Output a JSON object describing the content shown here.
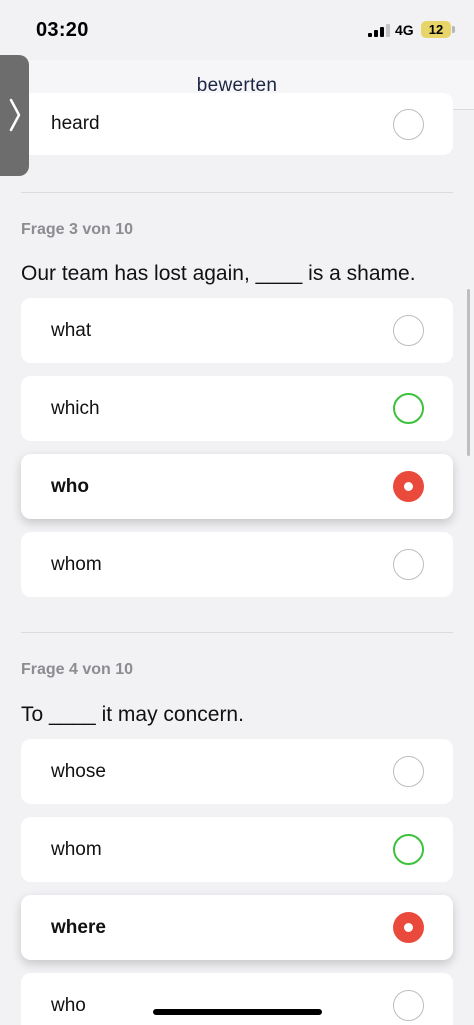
{
  "status_bar": {
    "time": "03:20",
    "network": "4G",
    "battery": "12",
    "battery_color": "#e8d56a"
  },
  "nav": {
    "title": "bewerten",
    "side_tab_icon": "chevron-right-icon"
  },
  "prev_question": {
    "options": [
      {
        "label": "heard",
        "state": "unselected"
      }
    ]
  },
  "questions": [
    {
      "counter": "Frage 3 von 10",
      "text": "Our team has lost again, ____ is a shame.",
      "options": [
        {
          "label": "what",
          "state": "unselected"
        },
        {
          "label": "which",
          "state": "correct"
        },
        {
          "label": "who",
          "state": "selected-wrong"
        },
        {
          "label": "whom",
          "state": "unselected"
        }
      ]
    },
    {
      "counter": "Frage 4 von 10",
      "text": "To ____ it may concern.",
      "options": [
        {
          "label": "whose",
          "state": "unselected"
        },
        {
          "label": "whom",
          "state": "correct"
        },
        {
          "label": "where",
          "state": "selected-wrong"
        },
        {
          "label": "who",
          "state": "unselected"
        }
      ]
    }
  ],
  "colors": {
    "correct": "#3cc23c",
    "wrong": "#ea4a3c",
    "title": "#1c2745",
    "counter": "#8c8c91"
  }
}
